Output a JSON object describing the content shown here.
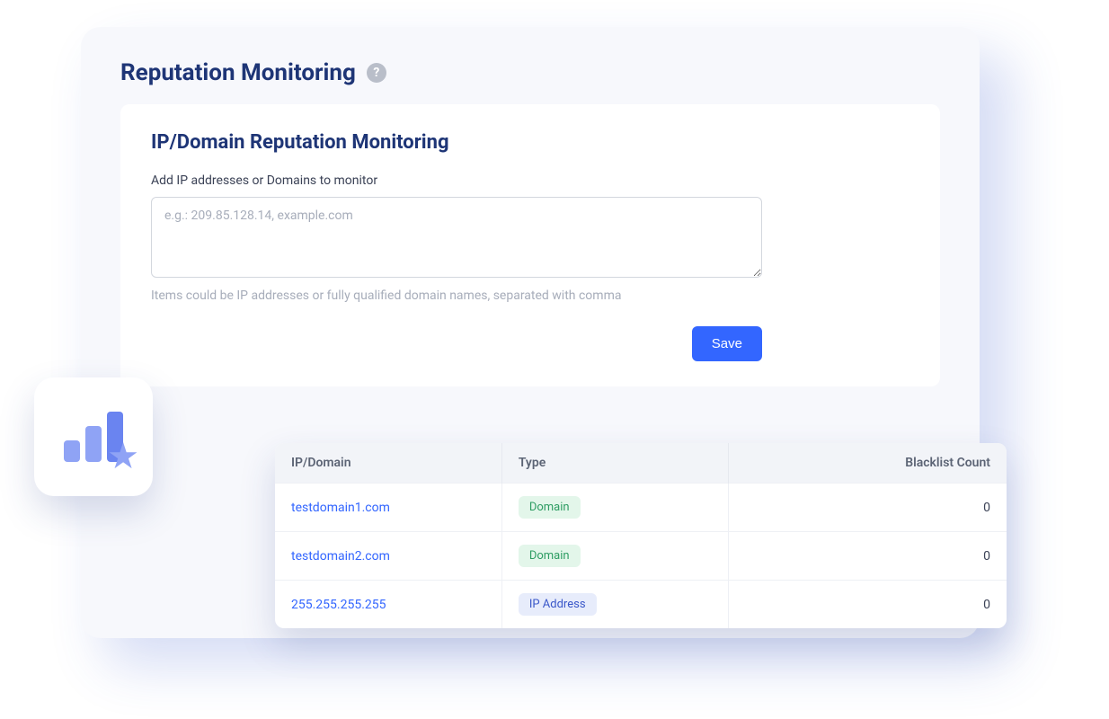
{
  "header": {
    "title": "Reputation Monitoring"
  },
  "panel": {
    "title": "IP/Domain Reputation Monitoring",
    "input_label": "Add IP addresses or Domains to monitor",
    "input_placeholder": "e.g.: 209.85.128.14, example.com",
    "helper_text": "Items could be IP addresses or fully qualified domain names, separated with comma",
    "save_label": "Save"
  },
  "table": {
    "columns": [
      "IP/Domain",
      "Type",
      "Blacklist Count"
    ],
    "rows": [
      {
        "ip_domain": "testdomain1.com",
        "type": "Domain",
        "type_kind": "domain",
        "blacklist_count": "0"
      },
      {
        "ip_domain": "testdomain2.com",
        "type": "Domain",
        "type_kind": "domain",
        "blacklist_count": "0"
      },
      {
        "ip_domain": "255.255.255.255",
        "type": "IP Address",
        "type_kind": "ip",
        "blacklist_count": "0"
      }
    ]
  }
}
